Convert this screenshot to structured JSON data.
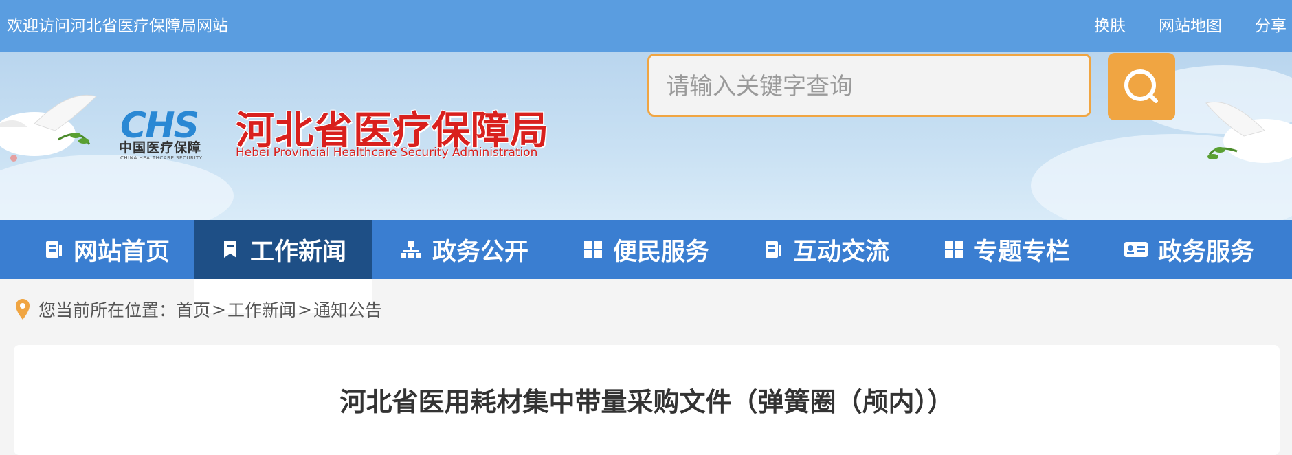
{
  "topbar": {
    "welcome": "欢迎访问河北省医疗保障局网站",
    "links": [
      "换肤",
      "网站地图",
      "分享"
    ]
  },
  "header": {
    "logo_abbr": "CHS",
    "logo_cn": "中国医疗保障",
    "logo_en": "CHINA HEALTHCARE SECURITY",
    "title": "河北省医疗保障局",
    "subtitle": "Hebei Provincial Healthcare Security Administration"
  },
  "search": {
    "placeholder": "请输入关键字查询"
  },
  "nav": {
    "items": [
      {
        "label": "网站首页",
        "icon": "document-icon"
      },
      {
        "label": "工作新闻",
        "icon": "bookmark-icon"
      },
      {
        "label": "政务公开",
        "icon": "sitemap-icon"
      },
      {
        "label": "便民服务",
        "icon": "grid-icon"
      },
      {
        "label": "互动交流",
        "icon": "document-icon"
      },
      {
        "label": "专题专栏",
        "icon": "grid-icon"
      },
      {
        "label": "政务服务",
        "icon": "id-card-icon"
      }
    ],
    "active_index": 1
  },
  "breadcrumb": {
    "prefix": "您当前所在位置：",
    "items": [
      "首页",
      "工作新闻",
      "通知公告"
    ],
    "separator": ">"
  },
  "article": {
    "title": "河北省医用耗材集中带量采购文件（弹簧圈（颅内））"
  },
  "colors": {
    "topbar": "#5a9de0",
    "nav": "#3a7ed1",
    "nav_active": "#1e4f86",
    "accent": "#f0a542",
    "title_red": "#d9201d"
  }
}
